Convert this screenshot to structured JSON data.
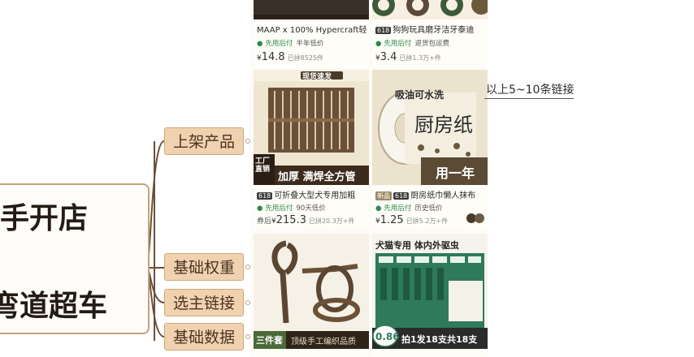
{
  "mindmap": {
    "title_lines": [
      "手开店",
      "弯道超车"
    ],
    "nodes": [
      "上架产品",
      "基础权重",
      "选主链接",
      "基础数据"
    ]
  },
  "annotation": "以上5~10条链接",
  "products": [
    {
      "title": "MAAP x 100% Hypercraft轻",
      "badges": [],
      "pay_labels": [
        "先用后付",
        "半年低价"
      ],
      "price_prefix": "",
      "price": "14.8",
      "sold": "已拼8525件"
    },
    {
      "title": "狗狗玩具磨牙洁牙泰迪",
      "badges": [
        "618"
      ],
      "pay_labels": [
        "先用后付",
        "退货包运费"
      ],
      "price_prefix": "",
      "price": "3.4",
      "sold": "已拼1.3万+件"
    },
    {
      "title": "可折叠大型犬专用加粗",
      "badges": [
        "618"
      ],
      "pay_labels": [
        "先用后付",
        "90天低价"
      ],
      "price_prefix": "券后",
      "price": "215.3",
      "sold": "已拼20.3万+件",
      "image_text": [
        "现货速发",
        "加厚 满焊全方管",
        "工厂直销"
      ]
    },
    {
      "title": "厨房纸巾懒人抹布",
      "badges": [
        "新品",
        "618"
      ],
      "pay_labels": [
        "先用后付",
        "历史低价"
      ],
      "price_prefix": "",
      "price": "1.25",
      "sold": "已拼5.2万+件",
      "image_text": [
        "吸油可水洗",
        "厨房纸",
        "用一年"
      ]
    },
    {
      "title": "",
      "image_text": [
        "三件套",
        "顶级手工编织品质"
      ]
    },
    {
      "title": "",
      "image_text": [
        "犬猫专用 体内外驱虫",
        "0.86",
        "拍1发18支共18支"
      ]
    }
  ],
  "currency": "¥",
  "colors": {
    "node_fill": "#f0d2b0",
    "node_border": "#d2a679",
    "title_box_border": "#c8a079",
    "green": "#2d8a4e"
  }
}
